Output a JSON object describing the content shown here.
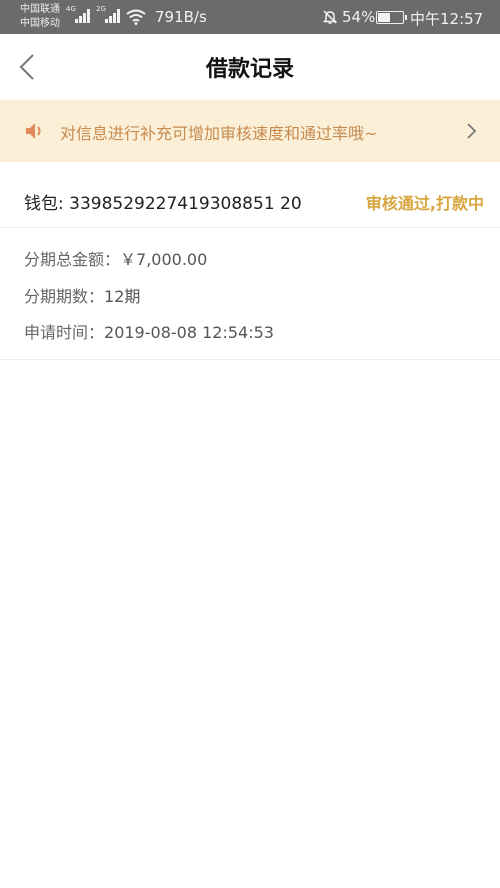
{
  "status_bar": {
    "carrier_1": "中国联通",
    "carrier_2": "中国移动",
    "network_1": "4G",
    "network_2": "2G",
    "speed": "791B/s",
    "battery": "54%",
    "battery_level": 0.54,
    "time": "中午12:57"
  },
  "header": {
    "title": "借款记录",
    "back_icon": "chevron-left-icon"
  },
  "notice": {
    "icon": "speaker-icon",
    "text": "对信息进行补充可增加审核速度和通过率哦~",
    "arrow_icon": "chevron-right-icon"
  },
  "record": {
    "wallet_label": "钱包: 3398529227419308851 20",
    "status": "审核通过,打款中",
    "details": [
      {
        "label": "分期总金额：",
        "value": "￥7,000.00"
      },
      {
        "label": "分期期数：",
        "value": "12期"
      },
      {
        "label": "申请时间：",
        "value": "2019-08-08 12:54:53"
      }
    ]
  },
  "colors": {
    "status_bar_bg": "#6b6b6b",
    "notice_bg": "#fbf0d7",
    "notice_text": "#c68a4f",
    "status_text": "#d9a53e"
  }
}
